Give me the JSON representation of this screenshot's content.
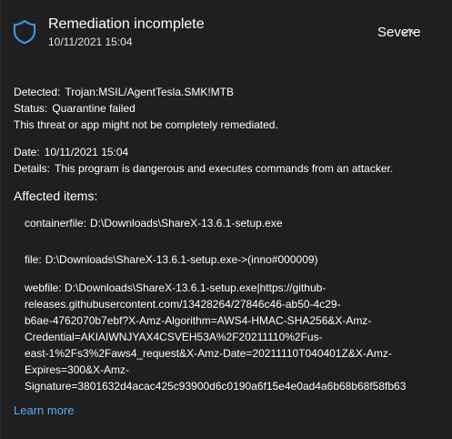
{
  "header": {
    "title": "Remediation incomplete",
    "timestamp": "10/11/2021 15:04",
    "severity": "Severe",
    "shield_icon": "shield-icon",
    "collapse_icon": "chevron-up-icon",
    "accent_color": "#3a96dd"
  },
  "details": {
    "detected_label": "Detected:",
    "detected_value": "Trojan:MSIL/AgentTesla.SMK!MTB",
    "status_label": "Status:",
    "status_value": "Quarantine failed",
    "status_note": "This threat or app might not be completely remediated.",
    "date_label": "Date:",
    "date_value": "10/11/2021 15:04",
    "details_label": "Details:",
    "details_value": "This program is dangerous and executes commands from an attacker."
  },
  "affected": {
    "title": "Affected items:",
    "items": [
      {
        "label": "containerfile:",
        "value": "D:\\Downloads\\ShareX-13.6.1-setup.exe"
      },
      {
        "label": "file:",
        "value": "D:\\Downloads\\ShareX-13.6.1-setup.exe->(inno#000009)"
      }
    ],
    "webfile": {
      "label": "webfile:",
      "lines": [
        "D:\\Downloads\\ShareX-13.6.1-setup.exe|https://github-",
        "releases.githubusercontent.com/13428264/27846c46-ab50-4c29-",
        "b6ae-4762070b7ebf?X-Amz-Algorithm=AWS4-HMAC-SHA256&X-Amz-",
        "Credential=AKIAIWNJYAX4CSVEH53A%2F20211110%2Fus-",
        "east-1%2Fs3%2Faws4_request&X-Amz-Date=20211110T040401Z&X-Amz-",
        "Expires=300&X-Amz-",
        "Signature=3801632d4acac425c93900d6c0190a6f15e4e0ad4a6b68b68f58fb63"
      ]
    }
  },
  "footer": {
    "learn_more": "Learn more",
    "link_color": "#5aaaf2"
  }
}
